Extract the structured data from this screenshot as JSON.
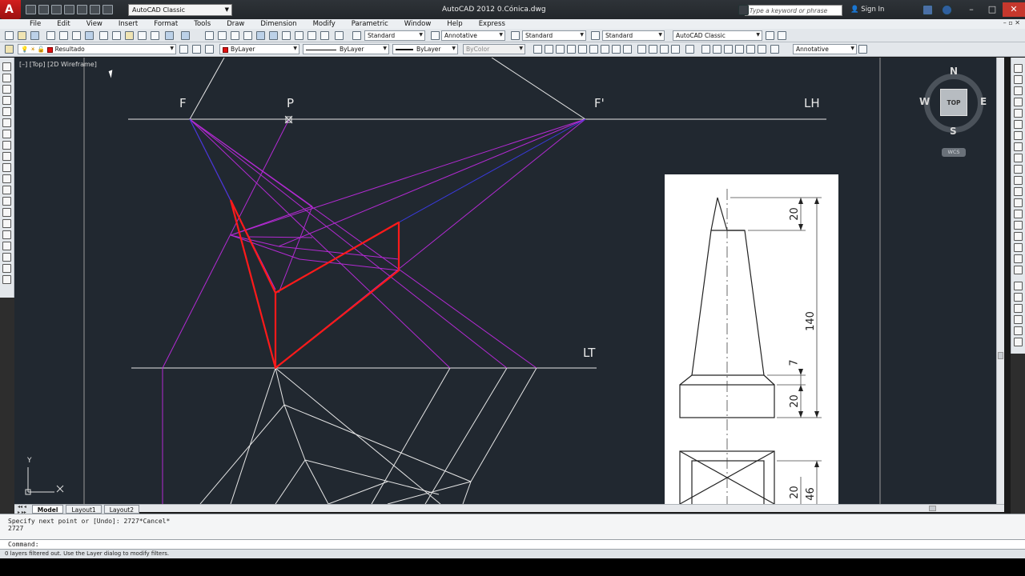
{
  "app": {
    "logo_letter": "A",
    "window_title": "AutoCAD 2012    0.Cónica.dwg",
    "workspace": "AutoCAD Classic",
    "search_placeholder": "Type a keyword or phrase",
    "sign_in": "Sign In",
    "window_controls": [
      "–",
      "□",
      "✕"
    ]
  },
  "menu": {
    "items": [
      "File",
      "Edit",
      "View",
      "Insert",
      "Format",
      "Tools",
      "Draw",
      "Dimension",
      "Modify",
      "Parametric",
      "Window",
      "Help",
      "Express"
    ],
    "controls": "– ▫ ✕"
  },
  "toolbar1": {
    "text_style": "Standard",
    "dim_style": "Annotative",
    "table_style": "Standard",
    "multileader_style": "Standard",
    "workspace": "AutoCAD Classic"
  },
  "toolbar2": {
    "layer": "Resultado",
    "color": "ByLayer",
    "linetype": "ByLayer",
    "lineweight": "ByLayer",
    "plotstyle": "ByColor",
    "annotation_scale": "Annotative"
  },
  "canvas": {
    "viewport_label": "[–] [Top] [2D Wireframe]",
    "labels": {
      "F": "F",
      "P": "P",
      "F_prime": "F'",
      "LH": "LH",
      "LT": "LT"
    },
    "ucs_y": "Y",
    "ucs_x": "X"
  },
  "viewcube": {
    "north": "N",
    "south": "S",
    "east": "E",
    "west": "W",
    "face": "TOP",
    "wcs": "WCS"
  },
  "sheet": {
    "dimensions": [
      "20",
      "140",
      "7",
      "20",
      "20",
      "46"
    ]
  },
  "layout_tabs": {
    "nav": "◂◂ ◂ ▸ ▸▸",
    "tabs": [
      "Model",
      "Layout1",
      "Layout2"
    ]
  },
  "command": {
    "history": [
      "Specify next point or [Undo]: 2727*Cancel*",
      "2727"
    ],
    "prompt": "Command:"
  },
  "status": {
    "message": "0 layers filtered out.  Use the Layer dialog to modify filters."
  },
  "colors": {
    "canvas_bg": "#212830",
    "construction_magenta": "#b32ad3",
    "result_red": "#ff1a1a",
    "line_white": "#e6e6e6",
    "title_bar": "#2e3338"
  }
}
